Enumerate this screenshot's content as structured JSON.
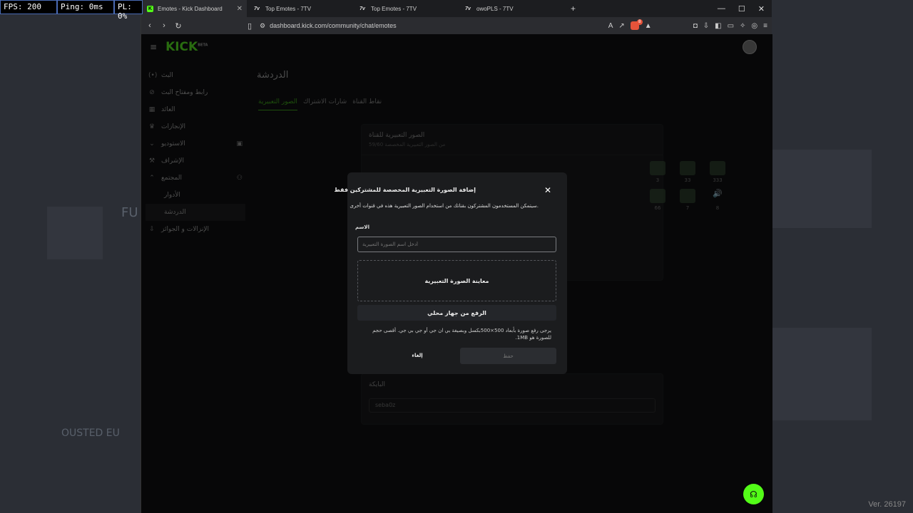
{
  "overlay": {
    "fps": "FPS: 200",
    "ping": "Ping: 0ms",
    "pl": "PL: 0%"
  },
  "backdrop": {
    "version": "Ver. 26197",
    "text1": "FU",
    "text2": "OUSTED EU"
  },
  "browser": {
    "tabs": [
      {
        "label": "Emotes - Kick Dashboard",
        "active": true
      },
      {
        "label": "Top Emotes - 7TV"
      },
      {
        "label": "Top Emotes - 7TV"
      },
      {
        "label": "owoPLS - 7TV"
      }
    ],
    "new_tab": "+",
    "window_controls": [
      "—",
      "☐",
      "✕"
    ],
    "url": "dashboard.kick.com/community/chat/emotes",
    "shield_badge": "8"
  },
  "app": {
    "logo": "KICK",
    "logo_sup": "BETA",
    "sidebar": [
      {
        "label": "البث",
        "icon": "(•)"
      },
      {
        "label": "رابط ومفتاح البث",
        "icon": "⊘"
      },
      {
        "label": "العائد",
        "icon": "▦"
      },
      {
        "label": "الإنجازات",
        "icon": "♛"
      },
      {
        "label": "الاستوديو",
        "icon": "⌄",
        "extra": "▣"
      },
      {
        "label": "الإشراف",
        "icon": "⚒"
      },
      {
        "label": "المجتمع",
        "icon": "⌃",
        "extra": "⚇"
      },
      {
        "label": "الأدوار",
        "sub": true
      },
      {
        "label": "الدردشة",
        "sub": true,
        "selected": true
      },
      {
        "label": "الإنزالات و الجوائز",
        "icon": "⇩"
      }
    ],
    "page_title": "الدردشة",
    "tabs": [
      "الصور التعبيرية",
      "شارات الاشتراك",
      "نقاط القناة"
    ],
    "emotes_card": {
      "title": "الصور التعبيرية للقناة",
      "subtitle": "59/60 من الصور التعبيرية المخصصة",
      "emotes": [
        {
          "count": "3"
        },
        {
          "count": "33"
        },
        {
          "count": "333"
        },
        {
          "count": ""
        },
        {
          "count": "66"
        },
        {
          "count": "7"
        },
        {
          "count": "8"
        }
      ]
    },
    "bot_card": {
      "label": "البايكة",
      "value": "seba0z"
    }
  },
  "modal": {
    "title": "إضافة الصورة التعبيرية المخصصة للمشتركين فقط",
    "close": "✕",
    "description": ".سيتمكن المستخدمون المشتركون بقناتك من استخدام الصور التعبيرية هذه في قنوات أخرى",
    "name_label": "الاسم",
    "name_placeholder": "أدخل اسم الصورة التعبيرية",
    "preview_label": "معاينة الصورة التعبيرية",
    "upload_label": "الرفع من جهاز محلي",
    "hint": "يرجى رفع صورة بأبعاد 500×500بكسل وبصيغة بي ان جي أو جي بي جي. أقصى حجم للصورة هو 1MB.",
    "cancel_label": "إلغاء",
    "save_label": "حفظ"
  },
  "colors": {
    "brand": "#53fc18",
    "page_bg": "#0b0c0d",
    "modal_bg": "#1b1c1e"
  }
}
